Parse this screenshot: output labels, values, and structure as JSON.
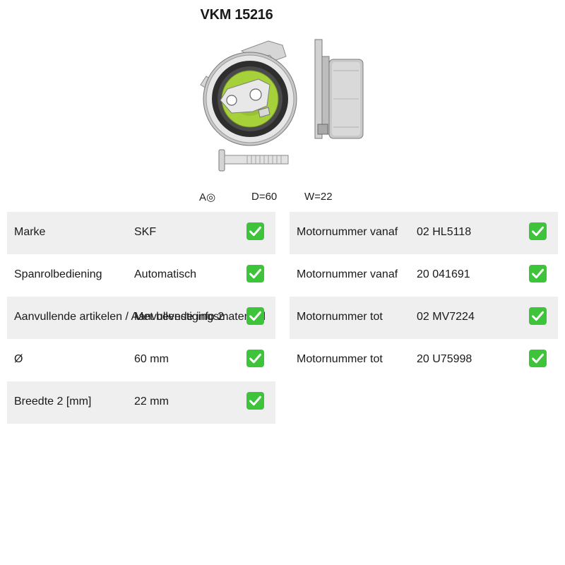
{
  "title": "VKM 15216",
  "image_alt": "SKF spanrol VKM 15216",
  "specs": {
    "a_label": "A◎",
    "d_label": "D=60",
    "w_label": "W=22"
  },
  "left_table": [
    {
      "label": "Marke",
      "value": "SKF"
    },
    {
      "label": "Spanrolbediening",
      "value": "Automatisch"
    },
    {
      "label": "Aanvullende artikelen / Aanvullende info 2",
      "value": "Met bevestigingsmateriaal"
    },
    {
      "label": "Ø",
      "value": "60 mm"
    },
    {
      "label": "Breedte 2 [mm]",
      "value": "22 mm"
    }
  ],
  "right_table": [
    {
      "label": "Motornummer vanaf",
      "value": "02 HL5118"
    },
    {
      "label": "Motornummer vanaf",
      "value": "20 041691"
    },
    {
      "label": "Motornummer tot",
      "value": "02 MV7224"
    },
    {
      "label": "Motornummer tot",
      "value": "20 U75998"
    }
  ],
  "colors": {
    "check_green": "#3ec43a",
    "row_shade": "#efefef",
    "pulley_green": "#a6d13b"
  },
  "icons": {
    "check": "white-heavy-check-mark-icon"
  }
}
